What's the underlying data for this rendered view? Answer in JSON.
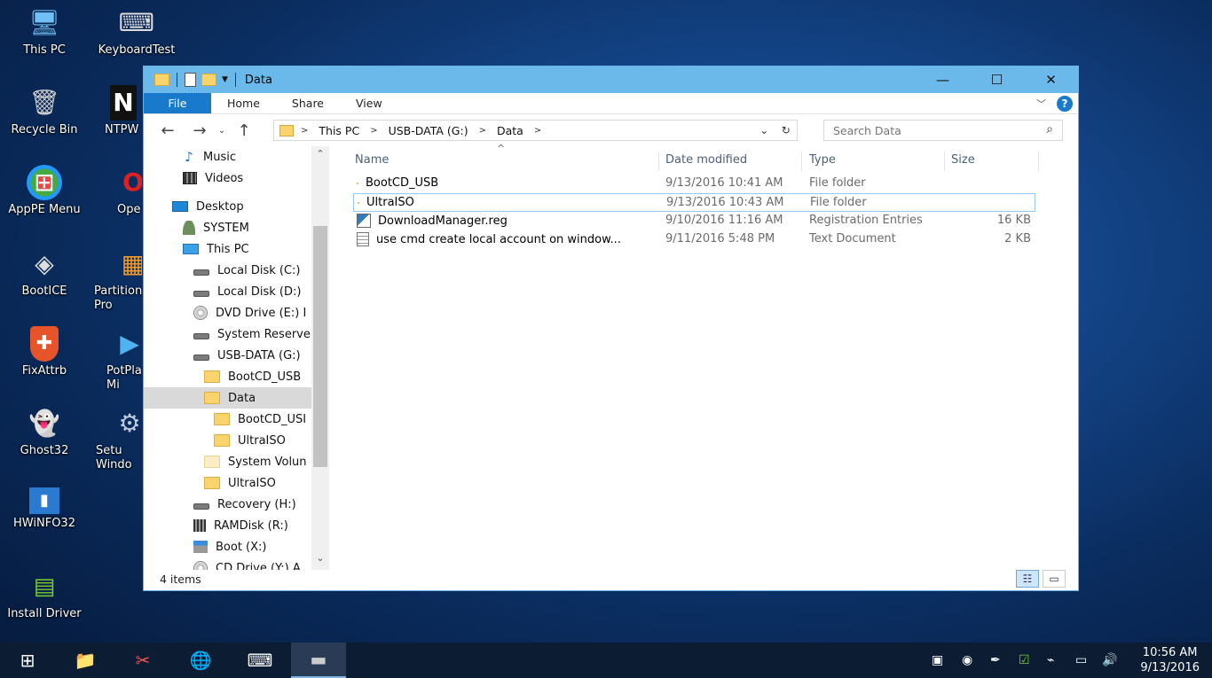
{
  "desktop": {
    "icons": [
      {
        "label": "This PC",
        "icon": "this-pc-icon",
        "glyph": "🖥"
      },
      {
        "label": "KeyboardTest",
        "icon": "keyboard-icon",
        "glyph": "⌨"
      },
      {
        "label": "Recycle Bin",
        "icon": "recycle-bin-icon",
        "glyph": "🗑"
      },
      {
        "label": "NTPW",
        "icon": "ntpw-icon",
        "glyph": "N"
      },
      {
        "label": "AppPE Menu",
        "icon": "apppe-menu-icon",
        "glyph": "⊞"
      },
      {
        "label": "Ope",
        "icon": "opera-icon",
        "glyph": "O"
      },
      {
        "label": "BootICE",
        "icon": "bootice-icon",
        "glyph": "◈"
      },
      {
        "label": "Partition Pro",
        "icon": "partition-icon",
        "glyph": "▦"
      },
      {
        "label": "FixAttrb",
        "icon": "fixattrb-icon",
        "glyph": "✚"
      },
      {
        "label": "PotPla Mi",
        "icon": "potplayer-icon",
        "glyph": "▶"
      },
      {
        "label": "Ghost32",
        "icon": "ghost-icon",
        "glyph": "👻"
      },
      {
        "label": "Setu Windo",
        "icon": "setup-windows-icon",
        "glyph": "⚙"
      },
      {
        "label": "HWiNFO32",
        "icon": "hwinfo-icon",
        "glyph": "▮"
      },
      {
        "label": "Install Driver",
        "icon": "install-driver-icon",
        "glyph": "▤"
      }
    ]
  },
  "window": {
    "title": "Data",
    "buttons": {
      "minimize": "—",
      "maximize": "☐",
      "close": "✕"
    }
  },
  "ribbon": {
    "tabs": [
      "File",
      "Home",
      "Share",
      "View"
    ],
    "expand": "﹀",
    "help": "?"
  },
  "nav": {
    "back": "←",
    "forward": "→",
    "recent": "⌄",
    "up": "↑",
    "path": [
      "This PC",
      "USB-DATA (G:)",
      "Data"
    ],
    "path_sep": ">",
    "dropdown": "⌄",
    "refresh": "↻"
  },
  "search": {
    "placeholder": "Search Data",
    "icon": "⌕"
  },
  "navpane": {
    "items": [
      {
        "label": "Music",
        "icon": "music"
      },
      {
        "label": "Videos",
        "icon": "video"
      },
      {
        "label": "Desktop",
        "icon": "desk"
      },
      {
        "label": "SYSTEM",
        "icon": "user"
      },
      {
        "label": "This PC",
        "icon": "pc"
      },
      {
        "label": "Local Disk (C:)",
        "icon": "drive"
      },
      {
        "label": "Local Disk (D:)",
        "icon": "drive"
      },
      {
        "label": "DVD Drive (E:) I",
        "icon": "dvd"
      },
      {
        "label": "System Reserve",
        "icon": "drive"
      },
      {
        "label": "USB-DATA (G:)",
        "icon": "drive"
      },
      {
        "label": "BootCD_USB",
        "icon": "folder"
      },
      {
        "label": "Data",
        "icon": "folder"
      },
      {
        "label": "BootCD_USI",
        "icon": "folder"
      },
      {
        "label": "UltraISO",
        "icon": "folder"
      },
      {
        "label": "System Volun",
        "icon": "folder-pale"
      },
      {
        "label": "UltraISO",
        "icon": "folder"
      },
      {
        "label": "Recovery (H:)",
        "icon": "drive"
      },
      {
        "label": "RAMDisk (R:)",
        "icon": "ram"
      },
      {
        "label": "Boot (X:)",
        "icon": "boot"
      },
      {
        "label": "CD Drive (Y:) A",
        "icon": "dvd"
      }
    ],
    "scroll_up": "⌃",
    "scroll_down": "⌄"
  },
  "columns": [
    "Name",
    "Date modified",
    "Type",
    "Size"
  ],
  "files": [
    {
      "name": "BootCD_USB",
      "date": "9/13/2016 10:41 AM",
      "type": "File folder",
      "size": "",
      "icon": "folder"
    },
    {
      "name": "UltraISO",
      "date": "9/13/2016 10:43 AM",
      "type": "File folder",
      "size": "",
      "icon": "folder"
    },
    {
      "name": "DownloadManager.reg",
      "date": "9/10/2016 11:16 AM",
      "type": "Registration Entries",
      "size": "16 KB",
      "icon": "reg"
    },
    {
      "name": "use cmd create local account on window...",
      "date": "9/11/2016 5:48 PM",
      "type": "Text Document",
      "size": "2 KB",
      "icon": "txt"
    }
  ],
  "status": {
    "count": "4 items"
  },
  "taskbar": {
    "start": "⊞",
    "apps": [
      "📁",
      "✂",
      "🌐",
      "⌨",
      "▬"
    ],
    "tray": [
      "▣",
      "◉",
      "✒",
      "☑",
      "⌁",
      "▭",
      "🔊"
    ],
    "time": "10:56 AM",
    "date": "9/13/2016"
  }
}
